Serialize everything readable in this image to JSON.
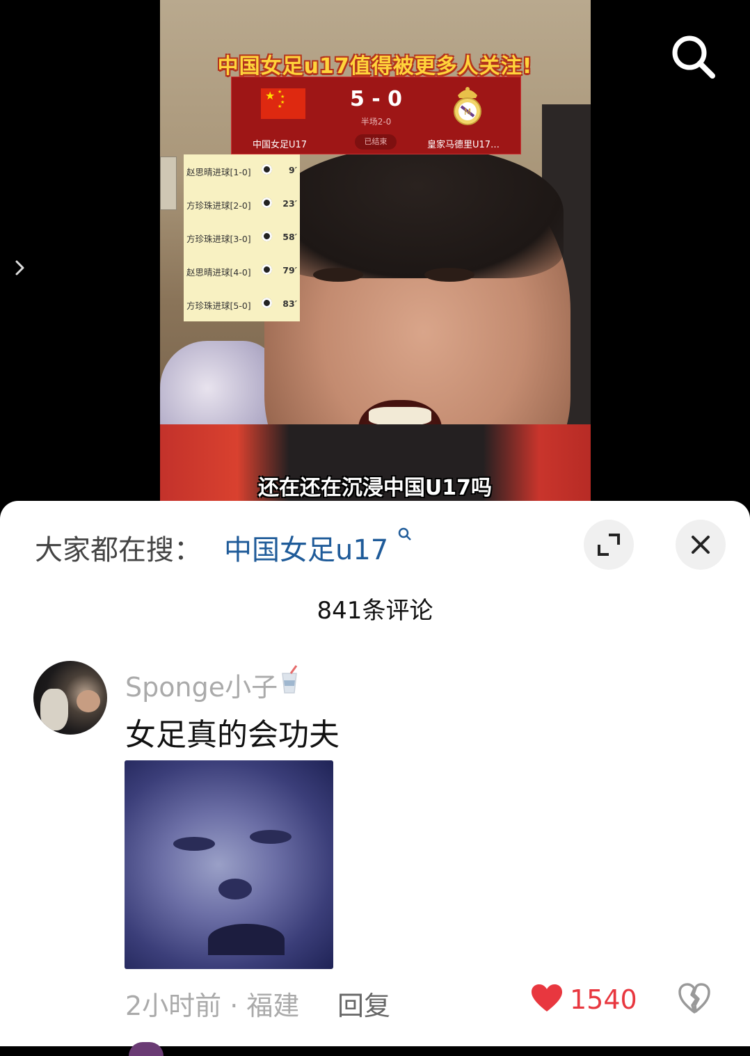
{
  "video": {
    "headline": "中国女足u17值得被更多人关注!",
    "scoreboard": {
      "score": "5 - 0",
      "half_time": "半场2-0",
      "home_team": "中国女足U17",
      "status": "已结束",
      "away_team": "皇家马德里U17…"
    },
    "goals": [
      {
        "text": "赵思晴进球[1-0]",
        "minute": "9′"
      },
      {
        "text": "方珍珠进球[2-0]",
        "minute": "23′"
      },
      {
        "text": "方珍珠进球[3-0]",
        "minute": "58′"
      },
      {
        "text": "赵思晴进球[4-0]",
        "minute": "79′"
      },
      {
        "text": "方珍珠进球[5-0]",
        "minute": "83′"
      }
    ],
    "caption": "还在还在沉浸中国U17吗"
  },
  "comments_panel": {
    "hot_search_label": "大家都在搜：",
    "hot_search_term": "中国女足u17",
    "comment_count": "841条评论",
    "comment": {
      "username": "Sponge小子",
      "text": "女足真的会功夫",
      "time_location": "2小时前 · 福建",
      "reply_label": "回复",
      "likes": "1540"
    }
  },
  "colors": {
    "headline": "#ffd43b",
    "scoreboard_bg": "#9e1616",
    "hot_search_link": "#1f5b99",
    "like_red": "#e8373f"
  },
  "icons": [
    "search-icon",
    "chevron-right-icon",
    "expand-icon",
    "close-icon",
    "cup-icon",
    "heart-icon",
    "broken-heart-icon"
  ]
}
